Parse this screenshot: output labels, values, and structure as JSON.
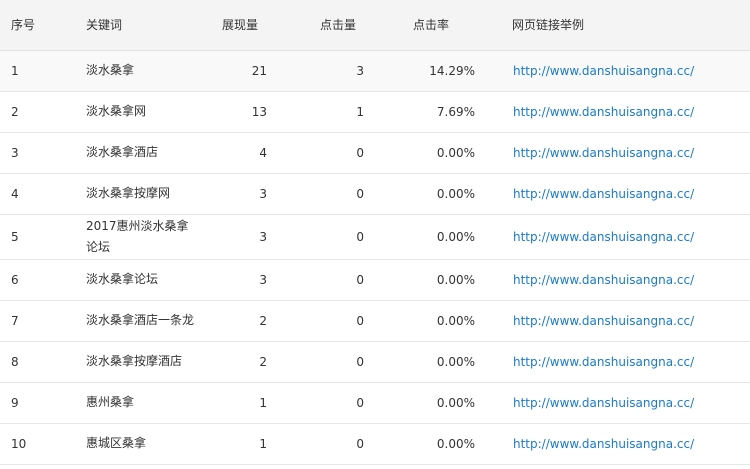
{
  "table": {
    "headers": {
      "index": "序号",
      "keyword": "关键词",
      "impressions": "展现量",
      "clicks": "点击量",
      "ctr": "点击率",
      "url": "网页链接举例"
    },
    "rows": [
      {
        "index": "1",
        "keyword": "淡水桑拿",
        "impressions": "21",
        "clicks": "3",
        "ctr": "14.29%",
        "url": "http://www.danshuisangna.cc/"
      },
      {
        "index": "2",
        "keyword": "淡水桑拿网",
        "impressions": "13",
        "clicks": "1",
        "ctr": "7.69%",
        "url": "http://www.danshuisangna.cc/"
      },
      {
        "index": "3",
        "keyword": "淡水桑拿酒店",
        "impressions": "4",
        "clicks": "0",
        "ctr": "0.00%",
        "url": "http://www.danshuisangna.cc/"
      },
      {
        "index": "4",
        "keyword": "淡水桑拿按摩网",
        "impressions": "3",
        "clicks": "0",
        "ctr": "0.00%",
        "url": "http://www.danshuisangna.cc/"
      },
      {
        "index": "5",
        "keyword": "2017惠州淡水桑拿论坛",
        "impressions": "3",
        "clicks": "0",
        "ctr": "0.00%",
        "url": "http://www.danshuisangna.cc/"
      },
      {
        "index": "6",
        "keyword": "淡水桑拿论坛",
        "impressions": "3",
        "clicks": "0",
        "ctr": "0.00%",
        "url": "http://www.danshuisangna.cc/"
      },
      {
        "index": "7",
        "keyword": "淡水桑拿酒店一条龙",
        "impressions": "2",
        "clicks": "0",
        "ctr": "0.00%",
        "url": "http://www.danshuisangna.cc/"
      },
      {
        "index": "8",
        "keyword": "淡水桑拿按摩酒店",
        "impressions": "2",
        "clicks": "0",
        "ctr": "0.00%",
        "url": "http://www.danshuisangna.cc/"
      },
      {
        "index": "9",
        "keyword": "惠州桑拿",
        "impressions": "1",
        "clicks": "0",
        "ctr": "0.00%",
        "url": "http://www.danshuisangna.cc/"
      },
      {
        "index": "10",
        "keyword": "惠城区桑拿",
        "impressions": "1",
        "clicks": "0",
        "ctr": "0.00%",
        "url": "http://www.danshuisangna.cc/"
      }
    ]
  },
  "colors": {
    "link": "#1a7ac8",
    "header_bg": "#f4f4f4",
    "text": "#333333"
  }
}
